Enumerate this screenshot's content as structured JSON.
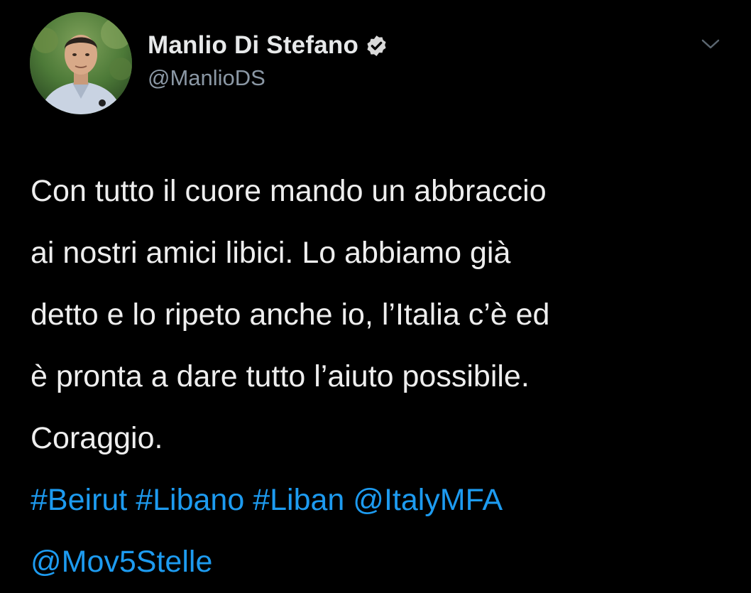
{
  "tweet": {
    "author": {
      "display_name": "Manlio Di Stefano",
      "handle": "@ManlioDS",
      "verified_icon": "verified-badge-icon"
    },
    "menu_icon": "chevron-down-icon",
    "text_lines": [
      "Con tutto il cuore mando un abbraccio",
      "ai nostri amici libici. Lo abbiamo già",
      "detto e lo ripeto anche io, l’Italia c’è ed",
      "è pronta a dare tutto l’aiuto possibile.",
      "Coraggio."
    ],
    "links_line_1": [
      "#Beirut",
      "#Libano",
      "#Liban",
      "@ItalyMFA"
    ],
    "links_line_2": [
      "@Mov5Stelle"
    ]
  },
  "colors": {
    "background": "#000000",
    "text": "#e7e9ea",
    "secondary": "#8b98a5",
    "link": "#1d9bf0"
  }
}
